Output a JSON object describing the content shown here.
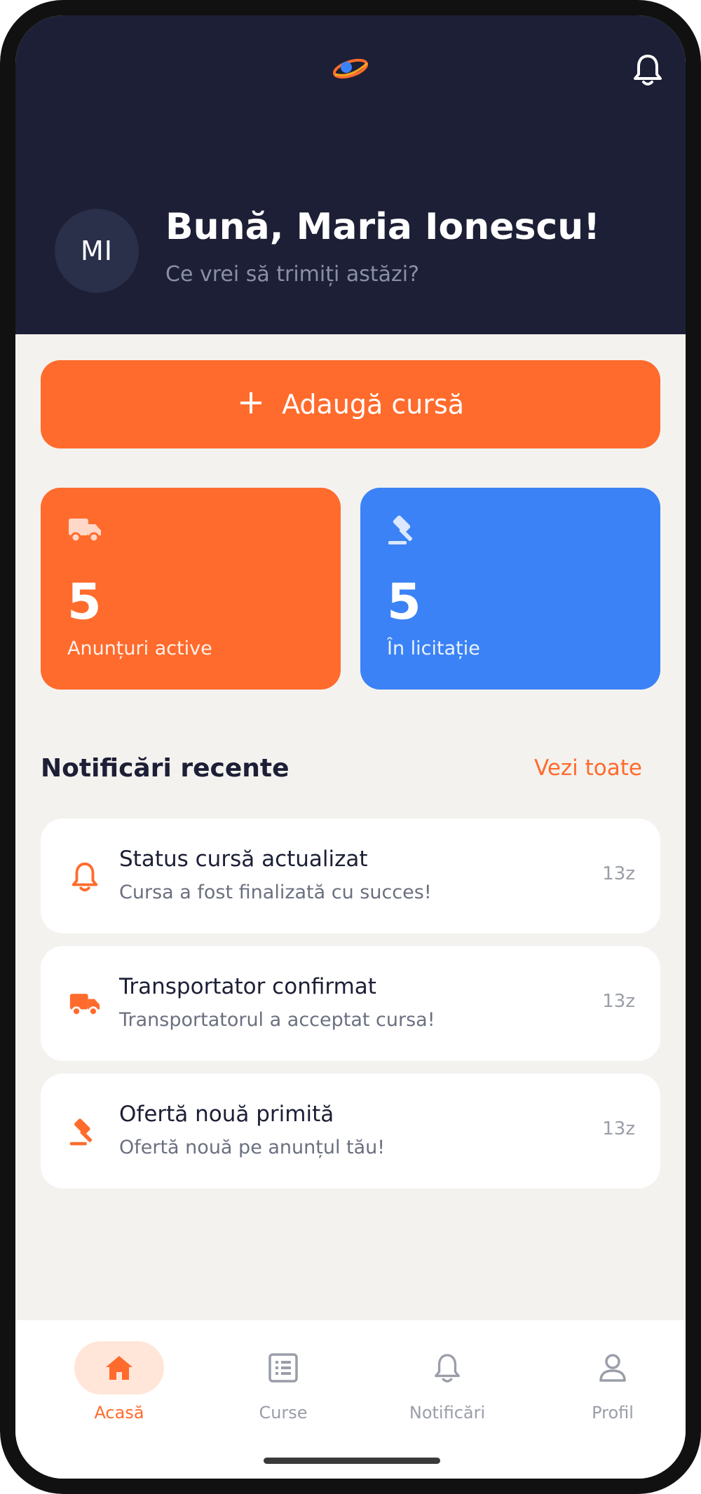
{
  "header": {
    "logo_icon": "brand-logo-icon",
    "avatar_initials": "MI",
    "greeting": "Bună, Maria Ionescu!",
    "subtitle": "Ce vrei să trimiți astăzi?"
  },
  "actions": {
    "add_ride_label": "Adaugă cursă",
    "add_ride_icon": "plus-icon"
  },
  "stats": [
    {
      "value": "5",
      "label": "Anunțuri active",
      "icon": "truck-icon",
      "color": "#ff6b2c"
    },
    {
      "value": "5",
      "label": "În licitație",
      "icon": "gavel-icon",
      "color": "#3b82f6"
    }
  ],
  "notifications_section": {
    "title": "Notificări recente",
    "see_all": "Vezi toate",
    "items": [
      {
        "icon": "bell-icon",
        "title": "Status cursă actualizat",
        "body": "Cursa a fost finalizată cu succes!",
        "time": "13z"
      },
      {
        "icon": "truck-icon",
        "title": "Transportator confirmat",
        "body": "Transportatorul a acceptat cursa!",
        "time": "13z"
      },
      {
        "icon": "gavel-icon",
        "title": "Ofertă nouă primită",
        "body": "Ofertă nouă pe anunțul tău!",
        "time": "13z"
      }
    ]
  },
  "nav": {
    "items": [
      {
        "label": "Acasă",
        "icon": "home-icon",
        "active": true
      },
      {
        "label": "Curse",
        "icon": "list-icon",
        "active": false
      },
      {
        "label": "Notificări",
        "icon": "bell-icon",
        "active": false
      },
      {
        "label": "Profil",
        "icon": "user-icon",
        "active": false
      }
    ]
  },
  "colors": {
    "header_bg": "#1c1f35",
    "accent_orange": "#ff6b2c",
    "accent_blue": "#3b82f6",
    "page_bg": "#f3f2ef"
  }
}
